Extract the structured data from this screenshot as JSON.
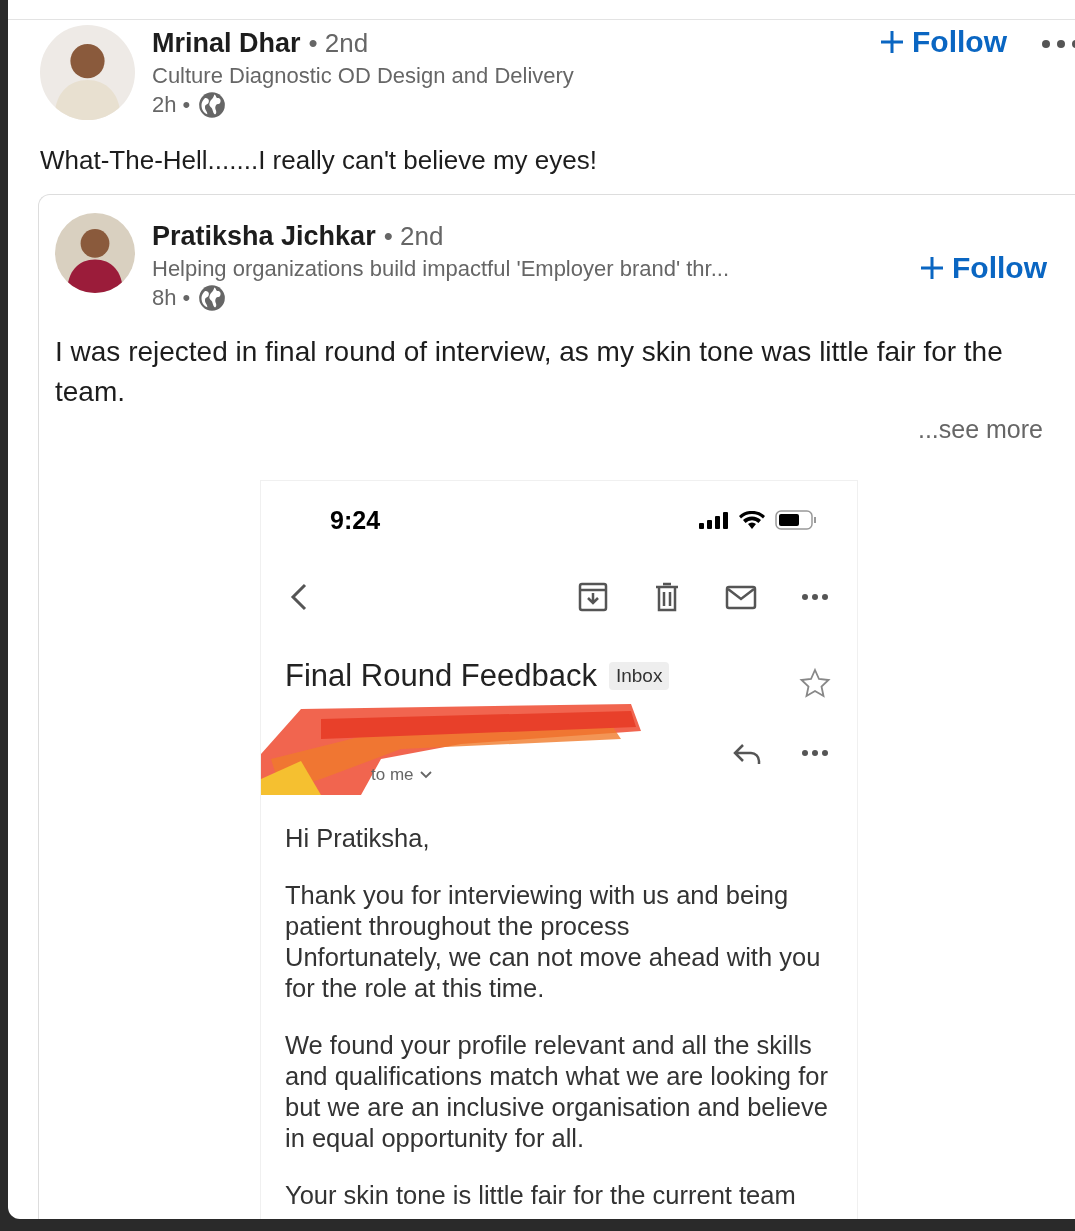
{
  "post": {
    "author": {
      "name": "Mrinal Dhar",
      "degree": "• 2nd",
      "headline": "Culture Diagnostic OD Design and Delivery",
      "time": "2h •"
    },
    "follow": "Follow",
    "text": "What-The-Hell.......I really can't believe my eyes!",
    "shared_post": {
      "author": {
        "name": "Pratiksha Jichkar",
        "degree": "• 2nd",
        "headline": "Helping organizations build impactful 'Employer brand' thr...",
        "time": "8h •"
      },
      "follow": "Follow",
      "text": "I was rejected in final round of interview, as my skin tone was little fair for the team.",
      "see_more": "...see more",
      "attachment": {
        "status_time": "9:24",
        "subject": "Final Round Feedback",
        "label": "Inbox",
        "recipient": "to me",
        "body": [
          "Hi Pratiksha,",
          "Thank you for interviewing with us and being\npatient throughout the process\nUnfortunately, we can not move ahead with you\nfor the role at this time.",
          "We found your profile relevant and all the skills\nand qualifications match what we are looking for\nbut we are an inclusive organisation and believe\nin equal opportunity for all.",
          "Your skin tone is little fair for the current team"
        ]
      }
    }
  }
}
